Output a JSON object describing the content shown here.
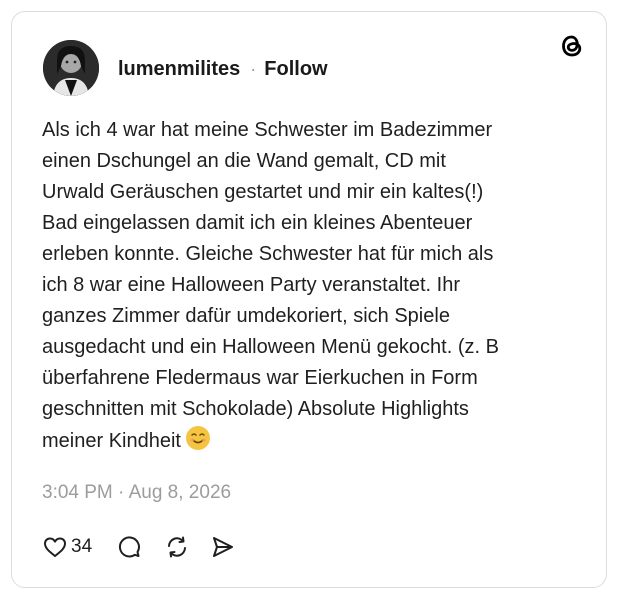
{
  "post": {
    "username": "lumenmilites",
    "separator": "·",
    "follow_label": "Follow",
    "text_lines": [
      "Als ich 4 war hat meine Schwester im Badezimmer",
      "einen Dschungel an die Wand gemalt, CD mit",
      "Urwald Geräuschen gestartet und mir ein kaltes(!)",
      "Bad eingelassen damit ich ein kleines  Abenteuer",
      "erleben konnte. Gleiche Schwester hat für mich als",
      "ich 8 war eine Halloween Party veranstaltet. Ihr",
      "ganzes Zimmer dafür umdekoriert, sich Spiele",
      "ausgedacht und ein Halloween Menü gekocht. (z. B",
      "überfahrene Fledermaus war Eierkuchen in Form",
      "geschnitten mit Schokolade) Absolute Highlights",
      "meiner Kindheit"
    ],
    "timestamp": "3:04 PM · Aug 8, 2026",
    "like_count": "34"
  },
  "icons": {
    "logo": "threads-logo-icon",
    "avatar": "profile-photo",
    "emoji": "smiling-face-emoji",
    "like": "heart-icon",
    "reply": "comment-icon",
    "repost": "repost-icon",
    "share": "send-icon"
  },
  "colors": {
    "text": "#1f1f1f",
    "muted": "#9c9c9c",
    "border": "#dcdcdc",
    "emoji": "#f5c542"
  }
}
